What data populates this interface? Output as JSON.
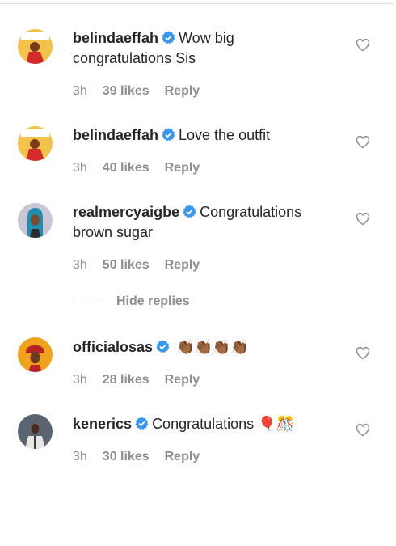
{
  "comments": [
    {
      "username": "belindaeffah",
      "text": "Wow big congratulations Sis",
      "time": "3h",
      "likes": "39 likes",
      "reply": "Reply",
      "avatar": "belindaeffah-avatar"
    },
    {
      "username": "belindaeffah",
      "text": "Love the outfit",
      "time": "3h",
      "likes": "40 likes",
      "reply": "Reply",
      "avatar": "belindaeffah-avatar"
    },
    {
      "username": "realmercyaigbe",
      "text": "Congratulations brown sugar",
      "time": "3h",
      "likes": "50 likes",
      "reply": "Reply",
      "avatar": "realmercyaigbe-avatar"
    },
    {
      "username": "officialosas",
      "text": "👏🏾👏🏾👏🏾👏🏾",
      "time": "3h",
      "likes": "28 likes",
      "reply": "Reply",
      "avatar": "officialosas-avatar"
    },
    {
      "username": "kenerics",
      "text": "Congratulations 🎈🎊",
      "time": "3h",
      "likes": "30 likes",
      "reply": "Reply",
      "avatar": "kenerics-avatar"
    }
  ],
  "hide_replies": "Hide replies",
  "colors": {
    "verified": "#3897f0",
    "meta": "#8e8e8e",
    "text": "#262626"
  }
}
